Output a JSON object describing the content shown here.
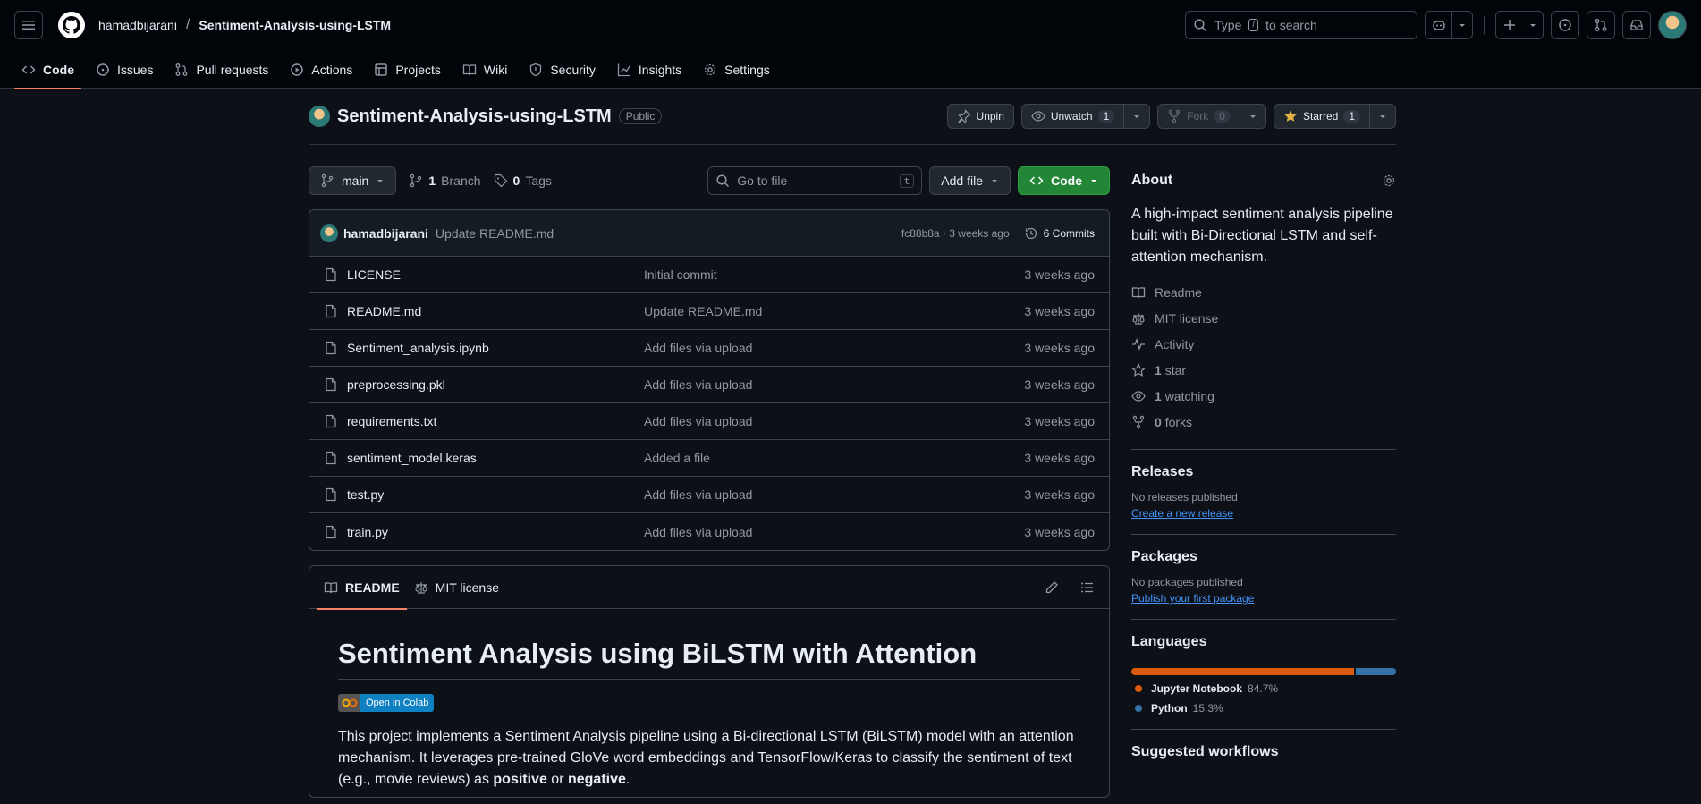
{
  "header": {
    "owner": "hamadbijarani",
    "separator": "/",
    "repo": "Sentiment-Analysis-using-LSTM",
    "search_prefix": "Type",
    "search_key": "/",
    "search_suffix": "to search"
  },
  "nav_tabs": [
    {
      "label": "Code",
      "icon": "code-icon"
    },
    {
      "label": "Issues",
      "icon": "issue-icon"
    },
    {
      "label": "Pull requests",
      "icon": "pull-request-icon"
    },
    {
      "label": "Actions",
      "icon": "play-icon"
    },
    {
      "label": "Projects",
      "icon": "table-icon"
    },
    {
      "label": "Wiki",
      "icon": "book-icon"
    },
    {
      "label": "Security",
      "icon": "shield-icon"
    },
    {
      "label": "Insights",
      "icon": "graph-icon"
    },
    {
      "label": "Settings",
      "icon": "gear-icon"
    }
  ],
  "repo_head": {
    "title": "Sentiment-Analysis-using-LSTM",
    "visibility": "Public",
    "unpin": "Unpin",
    "unwatch": "Unwatch",
    "watch_count": "1",
    "fork": "Fork",
    "fork_count": "0",
    "starred": "Starred",
    "star_count": "1"
  },
  "toolbar": {
    "branch": "main",
    "branch_count": "1",
    "branch_label": "Branch",
    "tag_count": "0",
    "tag_label": "Tags",
    "go_to_file": "Go to file",
    "go_to_file_key": "t",
    "add_file": "Add file",
    "code": "Code"
  },
  "commit": {
    "author": "hamadbijarani",
    "message": "Update README.md",
    "meta": "fc88b8a · 3 weeks ago",
    "commits_label": "6 Commits"
  },
  "files": [
    {
      "name": "LICENSE",
      "message": "Initial commit",
      "date": "3 weeks ago"
    },
    {
      "name": "README.md",
      "message": "Update README.md",
      "date": "3 weeks ago"
    },
    {
      "name": "Sentiment_analysis.ipynb",
      "message": "Add files via upload",
      "date": "3 weeks ago"
    },
    {
      "name": "preprocessing.pkl",
      "message": "Add files via upload",
      "date": "3 weeks ago"
    },
    {
      "name": "requirements.txt",
      "message": "Add files via upload",
      "date": "3 weeks ago"
    },
    {
      "name": "sentiment_model.keras",
      "message": "Added a file",
      "date": "3 weeks ago"
    },
    {
      "name": "test.py",
      "message": "Add files via upload",
      "date": "3 weeks ago"
    },
    {
      "name": "train.py",
      "message": "Add files via upload",
      "date": "3 weeks ago"
    }
  ],
  "readme": {
    "tab_readme": "README",
    "tab_license": "MIT license",
    "title": "Sentiment Analysis using BiLSTM with Attention",
    "badge": "Open in Colab",
    "para_1": "This project implements a Sentiment Analysis pipeline using a Bi-directional LSTM (BiLSTM) model with an attention mechanism. It leverages pre-trained GloVe word embeddings and TensorFlow/Keras to classify the sentiment of text (e.g., movie reviews) as ",
    "bold_positive": "positive",
    "para_or": " or ",
    "bold_negative": "negative",
    "para_end": "."
  },
  "about": {
    "title": "About",
    "description": "A high-impact sentiment analysis pipeline built with Bi-Directional LSTM and self-attention mechanism.",
    "readme": "Readme",
    "license": "MIT license",
    "activity": "Activity",
    "stars_count": "1",
    "stars_label": "star",
    "watching_count": "1",
    "watching_label": "watching",
    "forks_count": "0",
    "forks_label": "forks"
  },
  "releases": {
    "title": "Releases",
    "none": "No releases published",
    "create": "Create a new release"
  },
  "packages": {
    "title": "Packages",
    "none": "No packages published",
    "publish": "Publish your first package"
  },
  "languages": {
    "title": "Languages",
    "items": [
      {
        "name": "Jupyter Notebook",
        "percent": "84.7%",
        "value": 84.7,
        "color": "#DA5B0B"
      },
      {
        "name": "Python",
        "percent": "15.3%",
        "value": 15.3,
        "color": "#3572A5"
      }
    ]
  },
  "suggested": {
    "title": "Suggested workflows"
  },
  "colors": {
    "accent_green": "#238636",
    "tab_underline": "#f78166",
    "link": "#4493f8"
  }
}
